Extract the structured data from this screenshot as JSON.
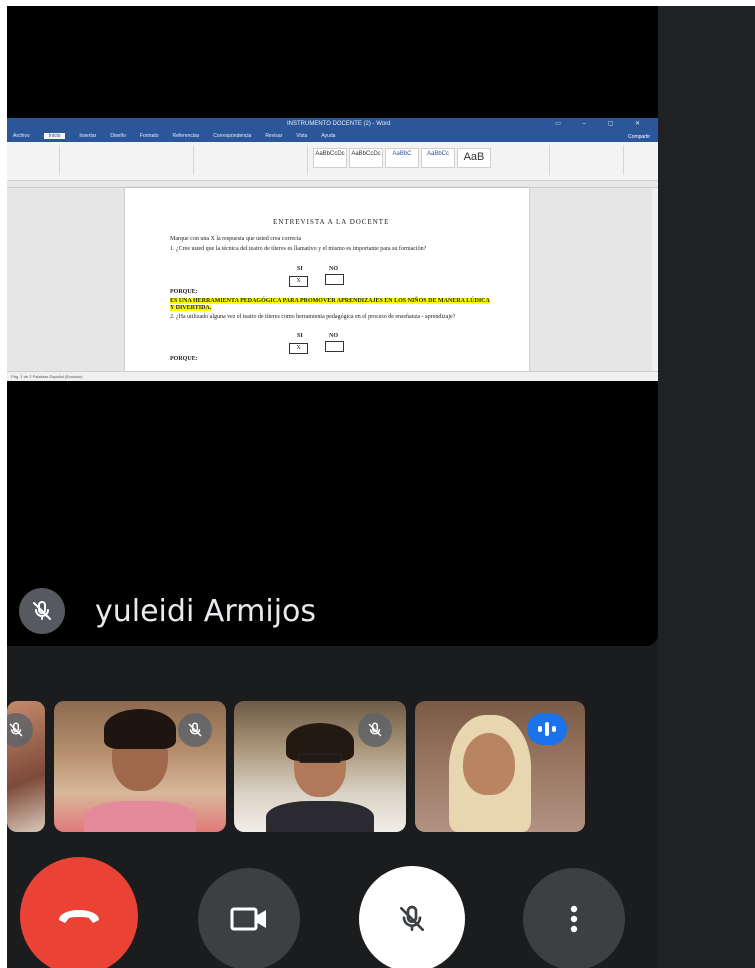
{
  "word": {
    "window_title": "INSTRUMENTO DOCENTE (2) - Word",
    "tabs": [
      "Archivo",
      "Inicio",
      "Insertar",
      "Diseño",
      "Formato",
      "Referencias",
      "Correspondencia",
      "Revisar",
      "Vista",
      "Ayuda"
    ],
    "active_tab": "Inicio",
    "styles": [
      "AaBbCcDc",
      "AaBbCcDc",
      "AaBbC",
      "AaBbCc",
      "AaB"
    ],
    "share_label": "Compartir",
    "status_text": "Pág. 1 de 2   Palabras   Español (Ecuador)"
  },
  "document": {
    "title": "ENTREVISTA A LA DOCENTE",
    "instruction": "Marque con una X la respuesta que usted crea correcta",
    "q1": "1. ¿Cree usted que la técnica del teatro de títeres es llamativo y el mismo es importante para su formación?",
    "si": "SI",
    "no": "NO",
    "mark": "X",
    "porque_label": "PORQUE:",
    "answer1": "ES UNA HERRAMIENTA PEDAGÓGICA PARA PROMOVER APRENDIZAJES EN LOS NIÑOS DE MANERA LÚDICA Y DIVERTIDA.",
    "q2": "2. ¿Ha utilizado alguna vez el teatro de títeres como herramienta pedagógica en el proceso de enseñanza - aprendizaje?"
  },
  "presenter": {
    "name": "yuleidi Armijos",
    "muted": true
  },
  "participants": [
    {
      "muted": true
    },
    {
      "muted": true
    },
    {
      "muted": true
    },
    {
      "speaking": true
    }
  ],
  "controls": {
    "end_call_color": "#ea4335",
    "mic_muted": true
  }
}
